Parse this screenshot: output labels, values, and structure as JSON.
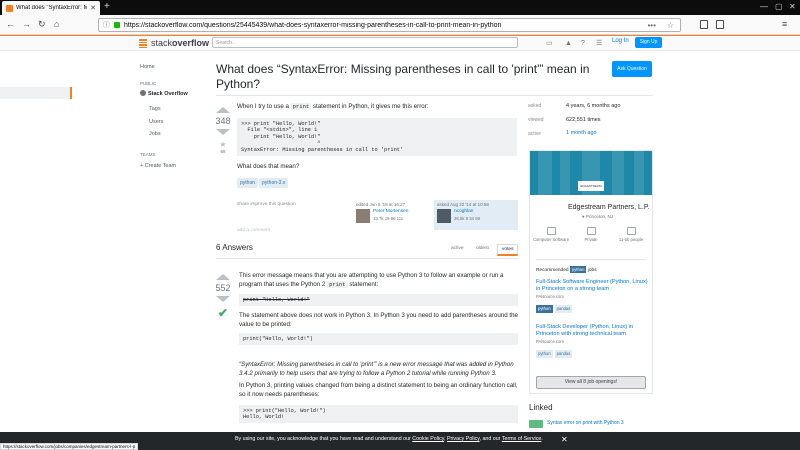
{
  "browser": {
    "tab_title": "What does \"SyntaxError: Missi",
    "url": "https://stackoverflow.com/questions/25445439/what-does-syntaxerror-missing-parentheses-in-call-to-print-mean-in-python",
    "status_url": "https://stackoverflow.com/jobs/companies/edgestream-partners-l-p"
  },
  "so_header": {
    "logo_light": "stack",
    "logo_bold": "overflow",
    "search_placeholder": "Search...",
    "login": "Log In",
    "signup": "Sign Up"
  },
  "left_nav": {
    "home": "Home",
    "public_heading": "PUBLIC",
    "stack_overflow": "Stack Overflow",
    "tags": "Tags",
    "users": "Users",
    "jobs": "Jobs",
    "teams_heading": "TEAMS",
    "create_team": "Create Team"
  },
  "question": {
    "title": "What does “SyntaxError: Missing parentheses in call to 'print'” mean in Python?",
    "ask_button": "Ask Question",
    "votes": "348",
    "favorites": "66",
    "intro_pre": "When I try to use a",
    "intro_code": "print",
    "intro_post": "statement in Python, it gives me this error:",
    "code_lines": [
      ">>> print \"Hello, World!\"",
      "  File \"<stdin>\", line 1",
      "    print \"Hello, World!\"",
      "                        ^",
      "SyntaxError: Missing parentheses in call to 'print'"
    ],
    "followup": "What does that mean?",
    "tags": [
      "python",
      "python-3.x"
    ],
    "post_menu": "share  improve this question",
    "edited_label": "edited Jun 5 '18 at 16:27",
    "editor_name": "Peter Mortensen",
    "editor_rep": "13.7k  19  86  111",
    "asked_label": "asked Aug 22 '14 at 10:58",
    "asker_name": "ncoghlan",
    "asker_rep": "26.5k  9  34  69",
    "add_comment": "add a comment"
  },
  "answers": {
    "count_label": "6 Answers",
    "sort_tabs": [
      "active",
      "oldest",
      "votes"
    ],
    "top_votes": "552",
    "p1_pre": "This error message means that you are attempting to use Python 3 to follow an example or run a program that uses the Python 2",
    "p1_code": "print",
    "p1_post": "statement:",
    "code1": "print \"Hello, World!\"",
    "p2": "The statement above does not work in Python 3. In Python 3 you need to add parentheses around the value to be printed:",
    "code2": "print(\"Hello, World!\")",
    "p3": "“SyntaxError: Missing parentheses in call to 'print'” is a new error message that was added in Python 3.4.2 primarily to help users that are trying to follow a Python 2 tutorial while running Python 3.",
    "p4": "In Python 3, printing values changed from being a distinct statement to being an ordinary function call, so it now needs parentheses:",
    "code3_lines": [
      ">>> print(\"Hello, World!\")",
      "Hello, World!"
    ]
  },
  "sidebar": {
    "asked_label": "asked",
    "asked_value": "4 years, 6 months ago",
    "viewed_label": "viewed",
    "viewed_value": "622,551 times",
    "active_label": "active",
    "active_value": "1 month ago",
    "ad": {
      "logo_text": "EDGESTREAM",
      "company": "Edgestream Partners, L.P.",
      "location": "Princeton, NJ",
      "stats": [
        "Computer Software",
        "Private",
        "11-50 people"
      ],
      "recommended_pre": "Recommended",
      "recommended_tag": "python",
      "recommended_post": "jobs",
      "job1_title": "Full-Stack Software Engineer (Python, Linux) in Princeton on a strong team",
      "job1_company": "PAlsource.com",
      "job1_tags": [
        "python",
        "pandas"
      ],
      "job2_title": "Full-Stack Developer (Python, Linux) in Princeton with strong technical team",
      "job2_company": "PAlsource.com",
      "job2_tags": [
        "python",
        "pandas"
      ],
      "view_all": "View all 8 job openings!"
    },
    "linked_heading": "Linked",
    "linked_badge": "5",
    "linked_item": "Syntax error on print with Python 3"
  },
  "cookie": {
    "pre": "By using our site, you acknowledge that you have read and understand our",
    "cookie_policy": "Cookie Policy",
    "sep1": ",",
    "privacy_policy": "Privacy Policy",
    "sep2": ", and our",
    "terms": "Terms of Service",
    "post": "."
  },
  "colors": {
    "accent": "#f48024",
    "link": "#0077cc",
    "button": "#0095ff",
    "accepted": "#48a868"
  }
}
